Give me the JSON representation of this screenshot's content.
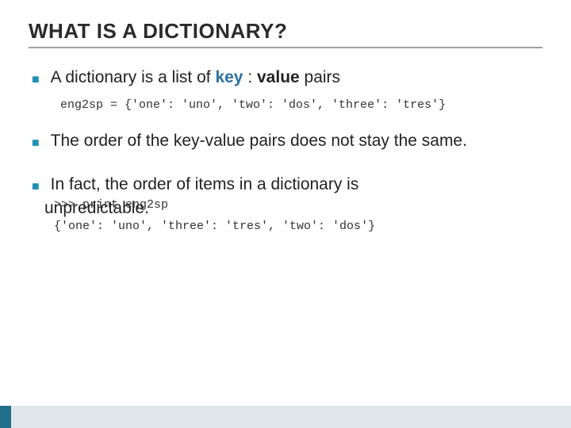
{
  "title": "WHAT IS A DICTIONARY?",
  "bullets": {
    "b1_pre": "A dictionary is a list of  ",
    "b1_key": "key",
    "b1_sep": " : ",
    "b1_value": "value",
    "b1_post": " pairs",
    "code1": "eng2sp = {'one': 'uno', 'two': 'dos', 'three': 'tres'}",
    "b2": "The order of the key-value pairs does not stay the same.",
    "b3_line1": "In fact, the order of items in a dictionary is",
    "b3_line2_word": "unpredictable.",
    "b3_overlay_code1": ">>> print eng2sp",
    "b3_overlay_code2": "{'one': 'uno', 'three': 'tres', 'two': 'dos'}"
  }
}
